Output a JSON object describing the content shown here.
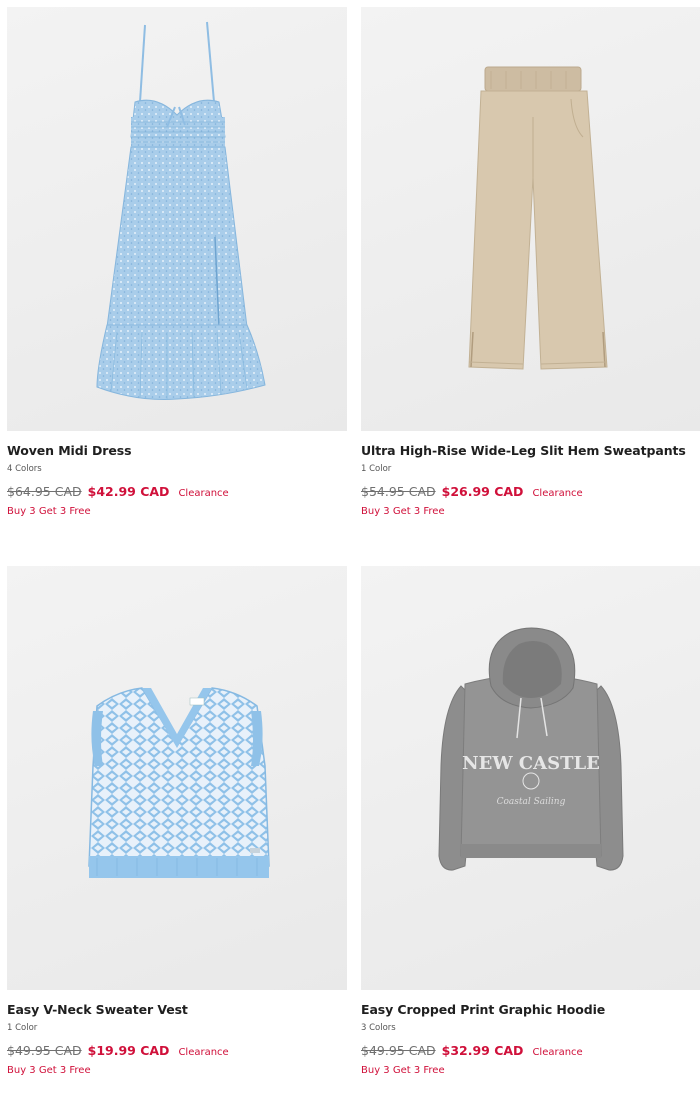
{
  "colors": {
    "sale": "#d0103a",
    "regular": "#707070",
    "background": "#ffffff"
  },
  "products": [
    {
      "name": "Woven Midi Dress",
      "colors_count": "4 Colors",
      "original_price": "$64.95 CAD",
      "sale_price": "$42.99 CAD",
      "badge": "Clearance",
      "promo": "Buy 3 Get 3 Free",
      "image": "blue-floral-midi-dress-image"
    },
    {
      "name": "Ultra High-Rise Wide-Leg Slit Hem Sweatpants",
      "colors_count": "1 Color",
      "original_price": "$54.95 CAD",
      "sale_price": "$26.99 CAD",
      "badge": "Clearance",
      "promo": "Buy 3 Get 3 Free",
      "image": "beige-sweatpants-image"
    },
    {
      "name": "Easy V-Neck Sweater Vest",
      "colors_count": "1 Color",
      "original_price": "$49.95 CAD",
      "sale_price": "$19.99 CAD",
      "badge": "Clearance",
      "promo": "Buy 3 Get 3 Free",
      "image": "blue-sweater-vest-image"
    },
    {
      "name": "Easy Cropped Print Graphic Hoodie",
      "colors_count": "3 Colors",
      "original_price": "$49.95 CAD",
      "sale_price": "$32.99 CAD",
      "badge": "Clearance",
      "promo": "Buy 3 Get 3 Free",
      "image": "grey-cropped-hoodie-image",
      "graphic_text": "NEW CASTLE",
      "graphic_subtext": "Coastal Sailing"
    }
  ]
}
